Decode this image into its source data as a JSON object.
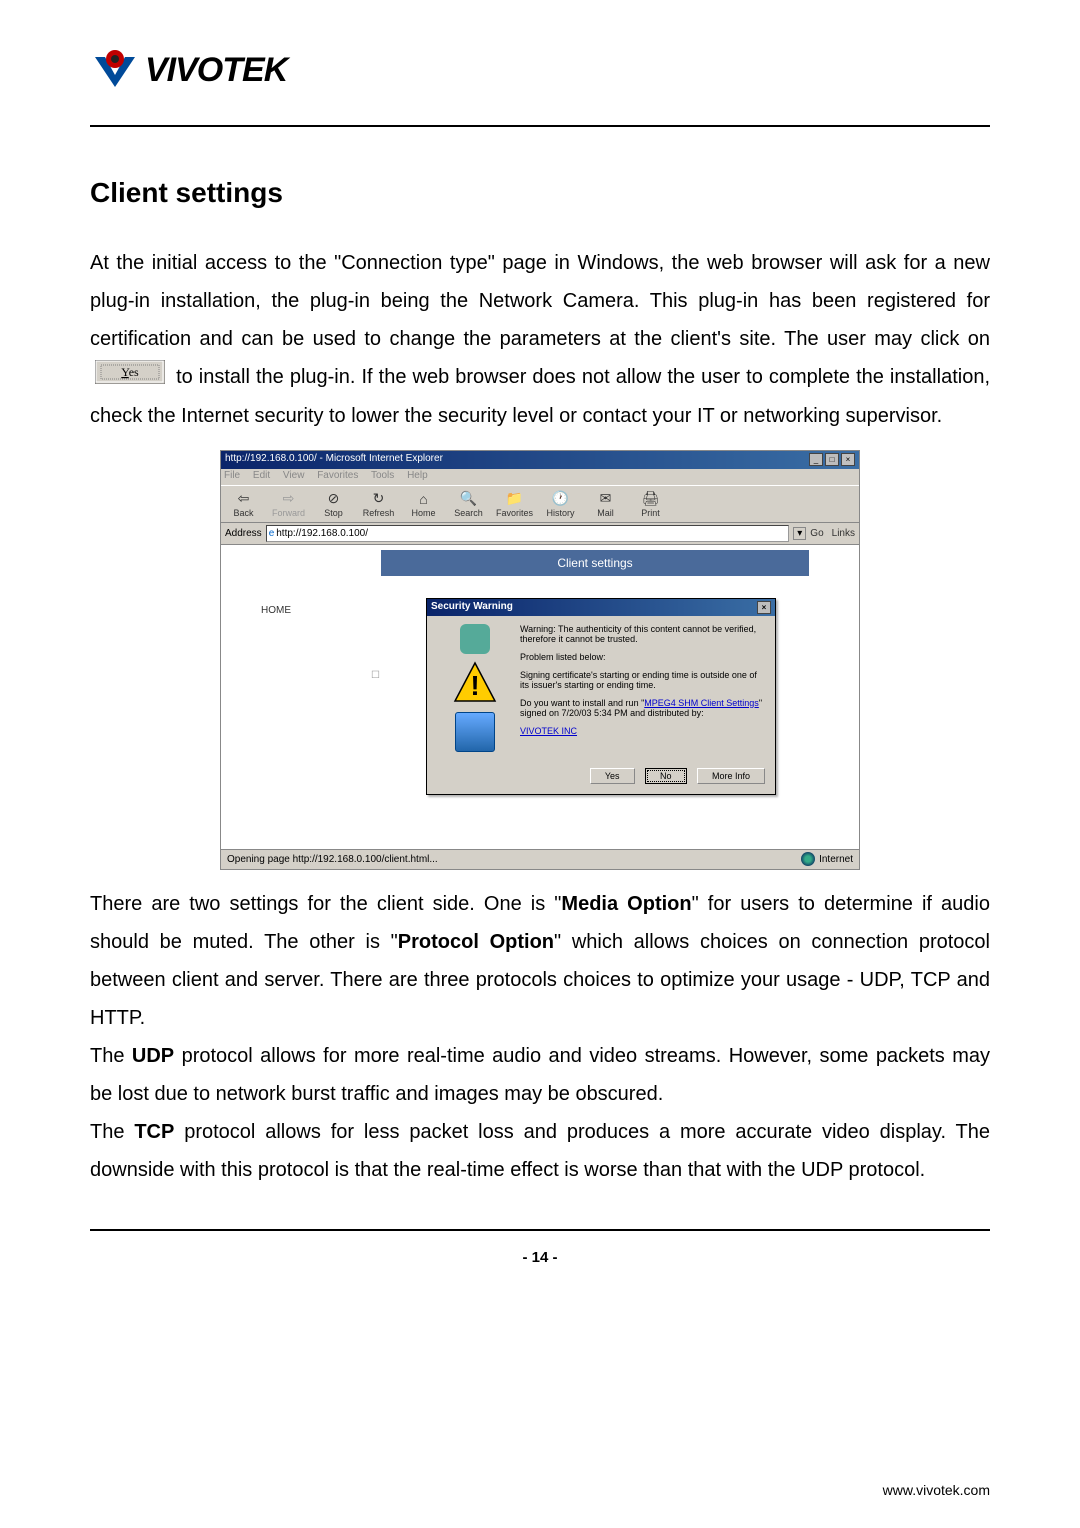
{
  "logo": {
    "text": "VIVOTEK"
  },
  "section": {
    "title": "Client settings"
  },
  "para1": {
    "part1": "At the initial access to the \"Connection type\" page in Windows, the web browser will ask for a new plug-in installation, the plug-in being the Network Camera. This plug-in has been registered for certification and can be used to change the parameters at the client's site. The user may click on ",
    "part2": " to install the plug-in. If the web browser does not allow the user to complete the installation, check the Internet security to lower the security level or contact your IT or networking supervisor."
  },
  "para2": "There are two settings for the client side. One is \"",
  "media_option": "Media Option",
  "para2b": "\" for users to determine if audio should be muted. The other is \"",
  "protocol_option": "Protocol Option",
  "para2c": "\" which allows choices on connection protocol between client and server. There are three protocols choices to optimize your usage - UDP, TCP and HTTP.",
  "para3a": "The ",
  "udp": "UDP",
  "para3b": " protocol allows for more real-time audio and video streams. However, some packets may be lost due to network burst traffic and images may be obscured.",
  "para4a": "The ",
  "tcp": "TCP",
  "para4b": " protocol allows for less packet loss and produces a more accurate video display. The downside with this protocol is that the real-time effect is worse than that with the UDP protocol.",
  "screenshot": {
    "titlebar": "http://192.168.0.100/ - Microsoft Internet Explorer",
    "menu": {
      "file": "File",
      "edit": "Edit",
      "view": "View",
      "favorites": "Favorites",
      "tools": "Tools",
      "help": "Help"
    },
    "toolbar": {
      "back": "Back",
      "forward": "Forward",
      "stop": "Stop",
      "refresh": "Refresh",
      "home": "Home",
      "search": "Search",
      "favorites": "Favorites",
      "history": "History",
      "mail": "Mail",
      "print": "Print"
    },
    "address_label": "Address",
    "address_value": "http://192.168.0.100/",
    "go": "Go",
    "links": "Links",
    "client_settings_header": "Client settings",
    "home_link": "HOME",
    "dialog": {
      "title": "Security Warning",
      "warning": "Warning: The authenticity of this content cannot be verified, therefore it cannot be trusted.",
      "problem": "Problem listed below:",
      "signing": "Signing certificate's starting or ending time is outside one of its issuer's starting or ending time.",
      "question": "Do you want to install and run \"",
      "link1": "MPEG4 SHM Client Settings",
      "question2": "\" signed on 7/20/03 5:34 PM and distributed by:",
      "vendor": "VIVOTEK INC",
      "yes": "Yes",
      "no": "No",
      "more": "More Info"
    },
    "statusbar": {
      "left": "Opening page http://192.168.0.100/client.html...",
      "right": "Internet"
    }
  },
  "footer": {
    "page_num": "- 14 -",
    "website": "www.vivotek.com"
  }
}
